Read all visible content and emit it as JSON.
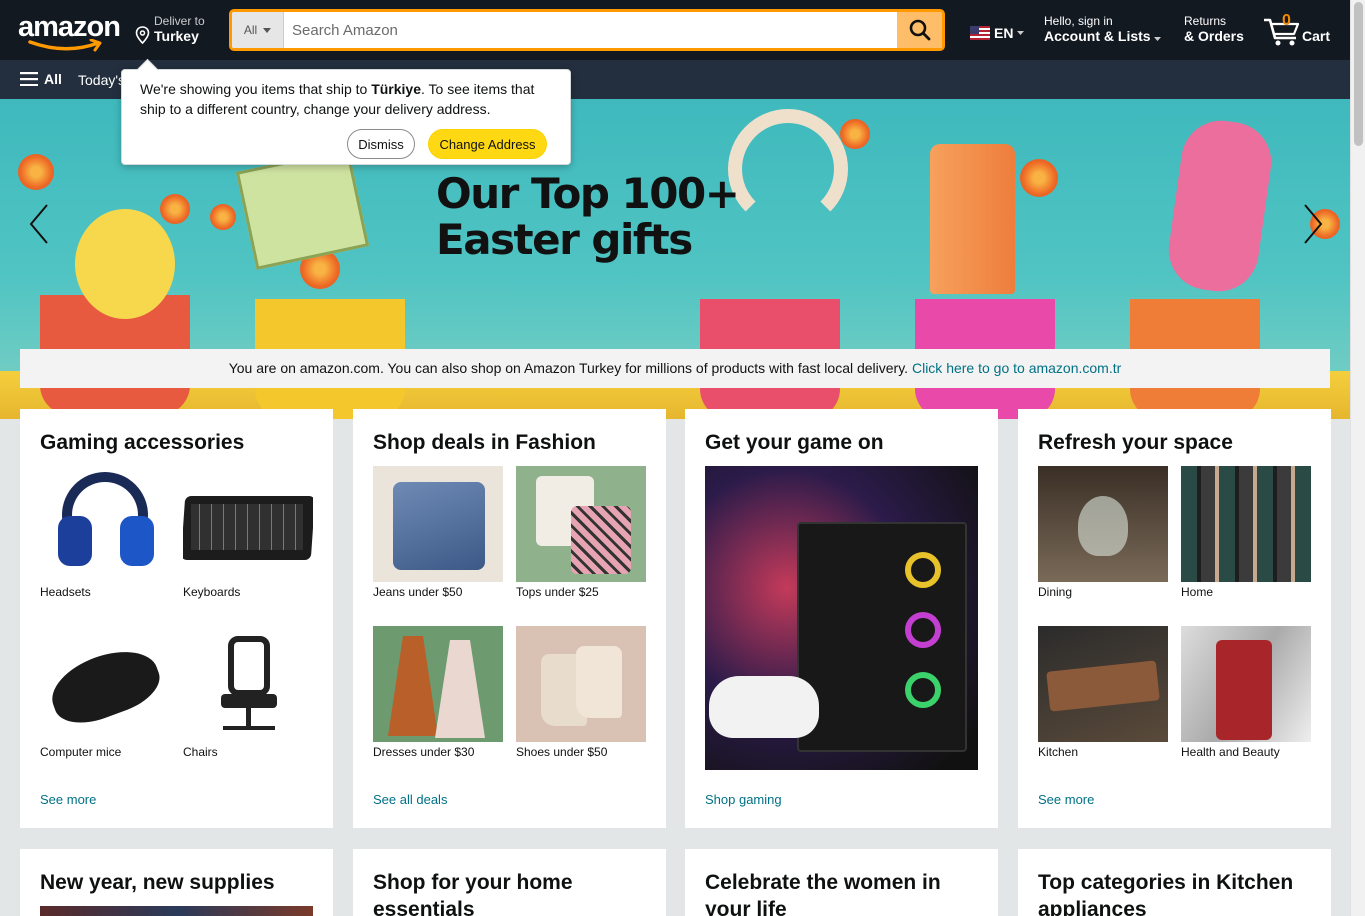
{
  "header": {
    "logo": "amazon",
    "deliver_l1": "Deliver to",
    "deliver_l2": "Turkey",
    "search_category": "All",
    "search_placeholder": "Search Amazon",
    "language": "EN",
    "account_l1": "Hello, sign in",
    "account_l2": "Account & Lists",
    "returns_l1": "Returns",
    "returns_l2": "& Orders",
    "cart_count": "0",
    "cart_label": "Cart"
  },
  "subnav": {
    "all_label": "All",
    "today_label": "Today's"
  },
  "popover": {
    "text_pre": "We're showing you items that ship to ",
    "country": "Türkiye",
    "text_post": ". To see items that ship to a different country, change your delivery address.",
    "dismiss": "Dismiss",
    "change": "Change Address"
  },
  "hero": {
    "title_l1": "Our Top 100+",
    "title_l2": "Easter gifts"
  },
  "banner": {
    "text": "You are on amazon.com. You can also shop on Amazon Turkey for millions of products with fast local delivery.",
    "link": "Click here to go to amazon.com.tr"
  },
  "cards": [
    {
      "title": "Gaming accessories",
      "tiles": [
        "Headsets",
        "Keyboards",
        "Computer mice",
        "Chairs"
      ],
      "link": "See more"
    },
    {
      "title": "Shop deals in Fashion",
      "tiles": [
        "Jeans under $50",
        "Tops under $25",
        "Dresses under $30",
        "Shoes under $50"
      ],
      "link": "See all deals"
    },
    {
      "title": "Get your game on",
      "link": "Shop gaming"
    },
    {
      "title": "Refresh your space",
      "tiles": [
        "Dining",
        "Home",
        "Kitchen",
        "Health and Beauty"
      ],
      "link": "See more"
    }
  ],
  "cards_row2": [
    "New year, new supplies",
    "Shop for your home essentials",
    "Celebrate the women in your life",
    "Top categories in Kitchen appliances"
  ],
  "colors": {
    "nav": "#131921",
    "subnav": "#232f3e",
    "accent": "#febd69",
    "link": "#007185",
    "cart_count": "#f08804"
  }
}
